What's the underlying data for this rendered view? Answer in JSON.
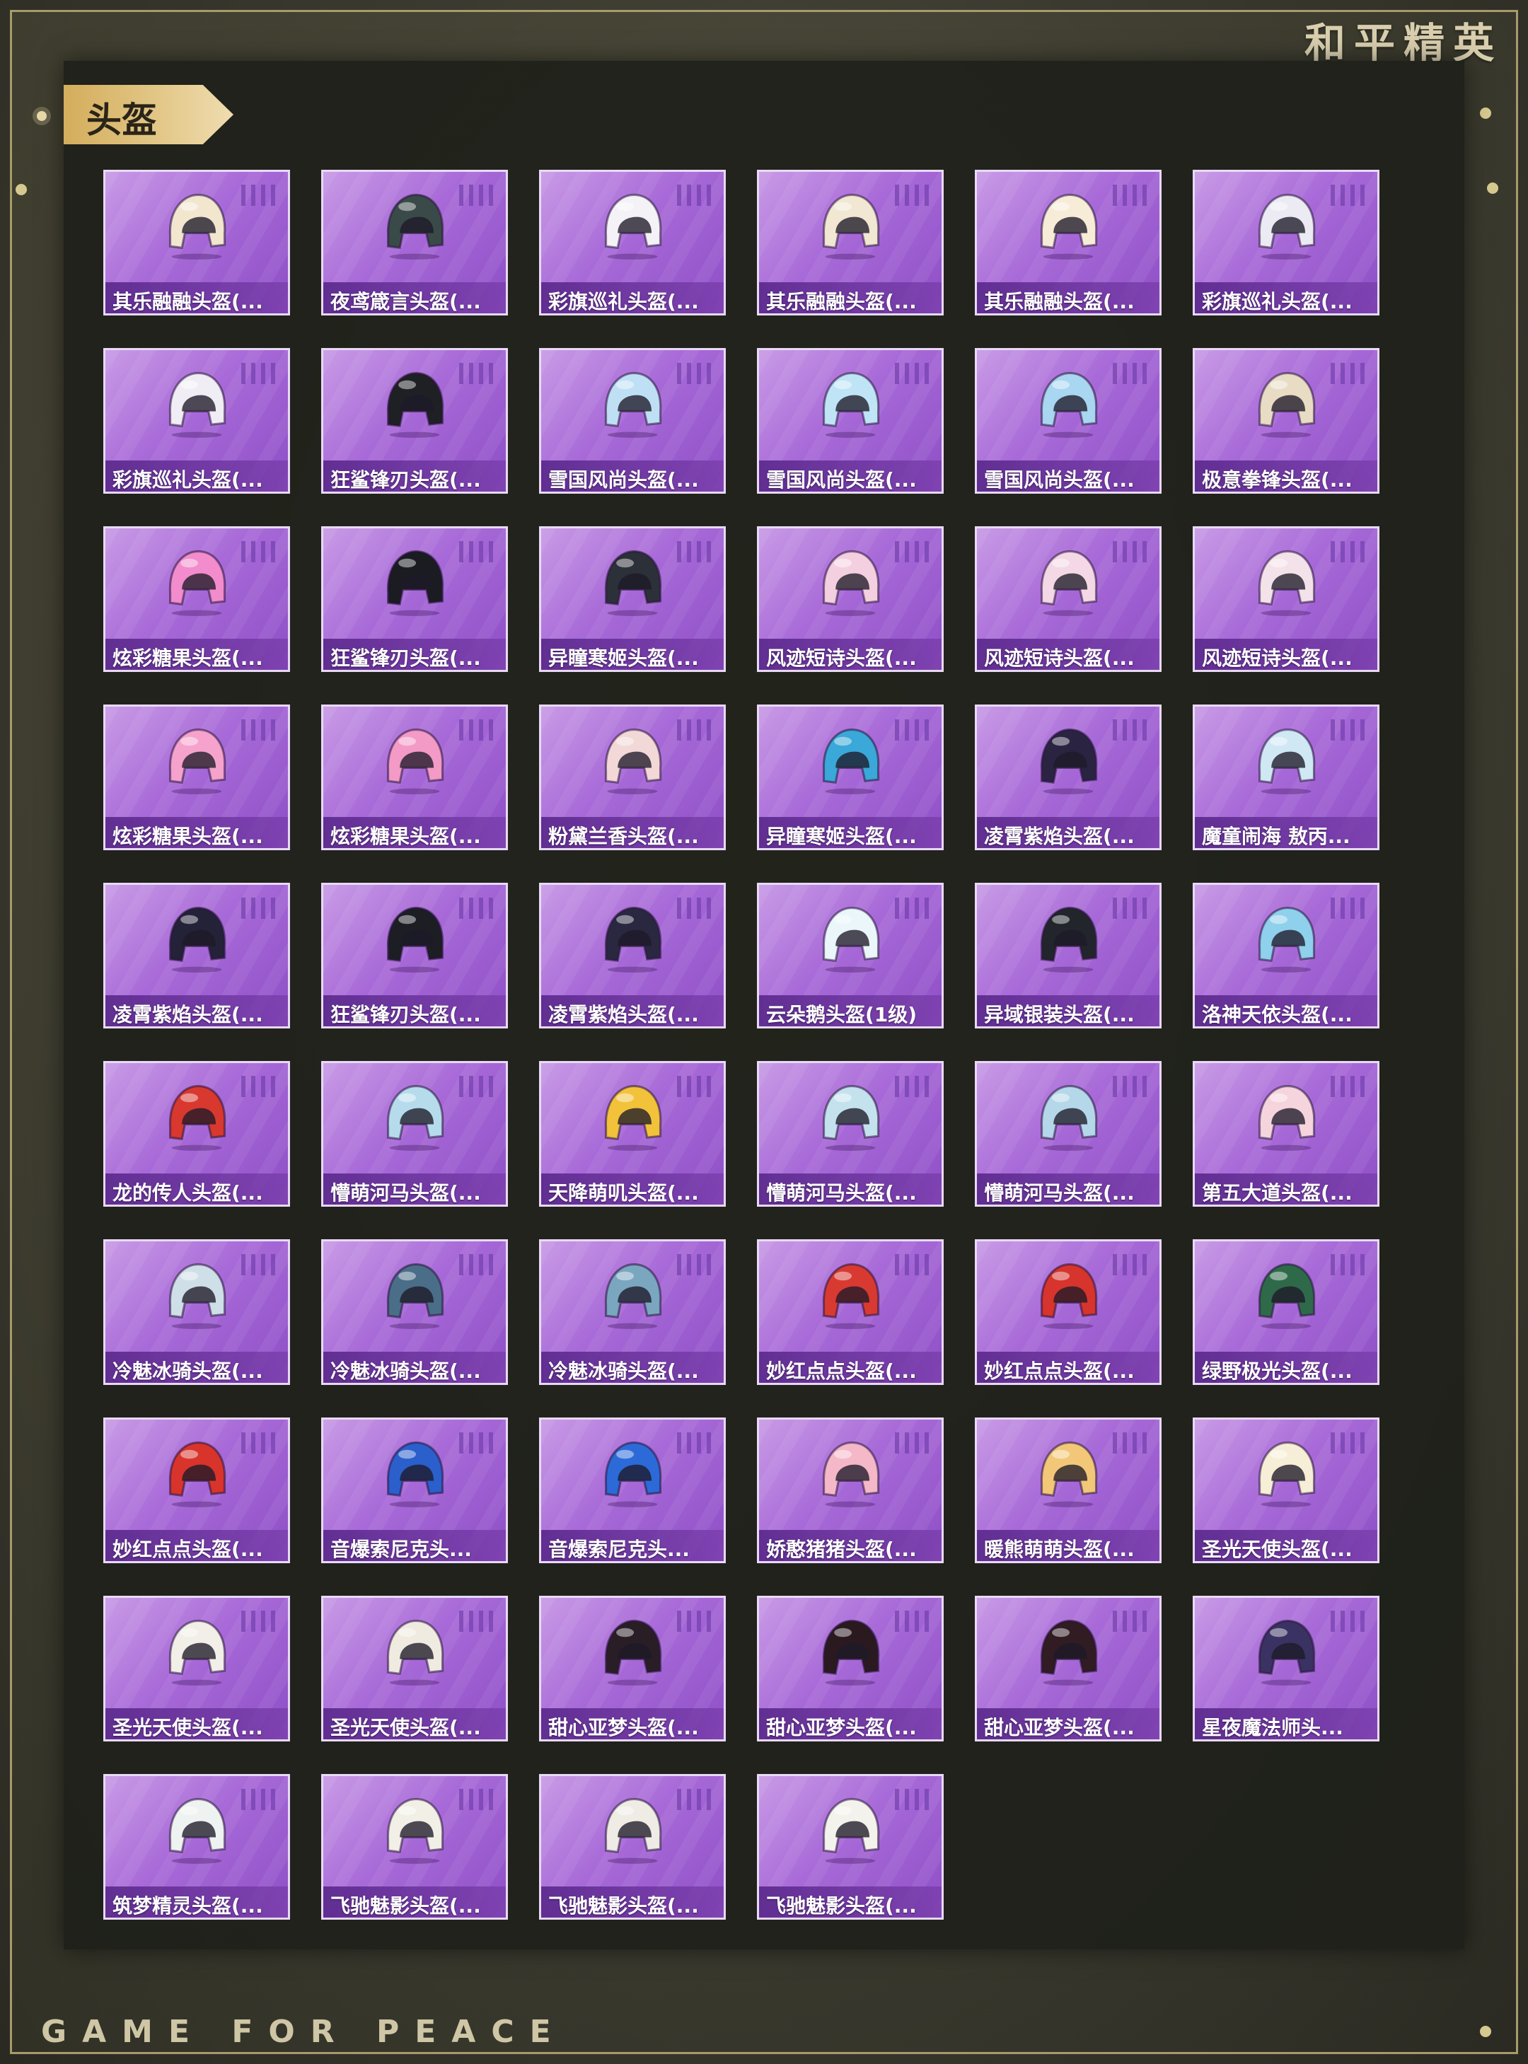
{
  "brand": {
    "title_cn": "和平精英",
    "title_en": "GAME FOR PEACE"
  },
  "section": {
    "title": "头盔"
  },
  "colors": {
    "card_purple": "#a86ad8",
    "frame_gold": "#a89a6a",
    "tab_gold": "#d4ad5c"
  },
  "items": [
    {
      "name": "其乐融融头盔(...",
      "icon": "helmet-icon",
      "color": "#f2e6cf"
    },
    {
      "name": "夜鸢箴言头盔(...",
      "icon": "helmet-icon",
      "color": "#3a4a48"
    },
    {
      "name": "彩旗巡礼头盔(...",
      "icon": "helmet-icon",
      "color": "#f4f2f6"
    },
    {
      "name": "其乐融融头盔(...",
      "icon": "helmet-icon",
      "color": "#f1e7d2"
    },
    {
      "name": "其乐融融头盔(...",
      "icon": "helmet-icon",
      "color": "#f7ecd8"
    },
    {
      "name": "彩旗巡礼头盔(...",
      "icon": "helmet-icon",
      "color": "#ecebf3"
    },
    {
      "name": "彩旗巡礼头盔(...",
      "icon": "helmet-icon",
      "color": "#f0eef4"
    },
    {
      "name": "狂鲨锋刃头盔(...",
      "icon": "helmet-icon",
      "color": "#1e2024"
    },
    {
      "name": "雪国风尚头盔(...",
      "icon": "helmet-icon",
      "color": "#bfe0f4"
    },
    {
      "name": "雪国风尚头盔(...",
      "icon": "helmet-icon",
      "color": "#bfe4f6"
    },
    {
      "name": "雪国风尚头盔(...",
      "icon": "helmet-icon",
      "color": "#a9d6f0"
    },
    {
      "name": "极意拳锋头盔(...",
      "icon": "helmet-icon",
      "color": "#e8dcc4"
    },
    {
      "name": "炫彩糖果头盔(...",
      "icon": "helmet-icon",
      "color": "#f28ccc"
    },
    {
      "name": "狂鲨锋刃头盔(...",
      "icon": "helmet-icon",
      "color": "#1a1c22"
    },
    {
      "name": "异瞳寒姬头盔(...",
      "icon": "helmet-icon",
      "color": "#2c3038"
    },
    {
      "name": "风迹短诗头盔(...",
      "icon": "helmet-icon",
      "color": "#f4cfe0"
    },
    {
      "name": "风迹短诗头盔(...",
      "icon": "helmet-icon",
      "color": "#f5d8e6"
    },
    {
      "name": "风迹短诗头盔(...",
      "icon": "helmet-icon",
      "color": "#f4e2ea"
    },
    {
      "name": "炫彩糖果头盔(...",
      "icon": "helmet-icon",
      "color": "#f5a2cc"
    },
    {
      "name": "炫彩糖果头盔(...",
      "icon": "helmet-icon",
      "color": "#f39ac6"
    },
    {
      "name": "粉黛兰香头盔(...",
      "icon": "helmet-icon",
      "color": "#f3d8d8"
    },
    {
      "name": "异瞳寒姬头盔(...",
      "icon": "helmet-icon",
      "color": "#3aa8d8"
    },
    {
      "name": "凌霄紫焰头盔(...",
      "icon": "helmet-icon",
      "color": "#2a2442"
    },
    {
      "name": "魔童闹海 敖丙...",
      "icon": "helmet-icon",
      "color": "#cfe8f4"
    },
    {
      "name": "凌霄紫焰头盔(...",
      "icon": "helmet-icon",
      "color": "#242238"
    },
    {
      "name": "狂鲨锋刃头盔(...",
      "icon": "helmet-icon",
      "color": "#1c1e24"
    },
    {
      "name": "凌霄紫焰头盔(...",
      "icon": "helmet-icon",
      "color": "#2a2840"
    },
    {
      "name": "云朵鹅头盔(1级)",
      "icon": "helmet-icon",
      "color": "#eaf6fa"
    },
    {
      "name": "异域银装头盔(...",
      "icon": "helmet-icon",
      "color": "#22262c"
    },
    {
      "name": "洛神天依头盔(...",
      "icon": "helmet-icon",
      "color": "#8fd0ec"
    },
    {
      "name": "龙的传人头盔(...",
      "icon": "helmet-icon",
      "color": "#d8382e"
    },
    {
      "name": "懵萌河马头盔(...",
      "icon": "helmet-icon",
      "color": "#b6dcec"
    },
    {
      "name": "天降萌叽头盔(...",
      "icon": "helmet-icon",
      "color": "#f2c23a"
    },
    {
      "name": "懵萌河马头盔(...",
      "icon": "helmet-icon",
      "color": "#c4e2ee"
    },
    {
      "name": "懵萌河马头盔(...",
      "icon": "helmet-icon",
      "color": "#b4d8ea"
    },
    {
      "name": "第五大道头盔(...",
      "icon": "helmet-icon",
      "color": "#f6d4de"
    },
    {
      "name": "冷魅冰骑头盔(...",
      "icon": "helmet-icon",
      "color": "#cfdfe8"
    },
    {
      "name": "冷魅冰骑头盔(...",
      "icon": "helmet-icon",
      "color": "#4a6e88"
    },
    {
      "name": "冷魅冰骑头盔(...",
      "icon": "helmet-icon",
      "color": "#7aa6c0"
    },
    {
      "name": "妙红点点头盔(...",
      "icon": "helmet-icon",
      "color": "#d83a32"
    },
    {
      "name": "妙红点点头盔(...",
      "icon": "helmet-icon",
      "color": "#d6342c"
    },
    {
      "name": "绿野极光头盔(...",
      "icon": "helmet-icon",
      "color": "#2e6a4a"
    },
    {
      "name": "妙红点点头盔(...",
      "icon": "helmet-icon",
      "color": "#d8342c"
    },
    {
      "name": "音爆索尼克头...",
      "icon": "helmet-icon",
      "color": "#2a5fcc"
    },
    {
      "name": "音爆索尼克头...",
      "icon": "helmet-icon",
      "color": "#2c6ad8"
    },
    {
      "name": "娇憨猪猪头盔(...",
      "icon": "helmet-icon",
      "color": "#f4b8c8"
    },
    {
      "name": "暖熊萌萌头盔(...",
      "icon": "helmet-icon",
      "color": "#f2c878"
    },
    {
      "name": "圣光天使头盔(...",
      "icon": "helmet-icon",
      "color": "#f6eed6"
    },
    {
      "name": "圣光天使头盔(...",
      "icon": "helmet-icon",
      "color": "#f2efe8"
    },
    {
      "name": "圣光天使头盔(...",
      "icon": "helmet-icon",
      "color": "#f0ebe0"
    },
    {
      "name": "甜心亚梦头盔(...",
      "icon": "helmet-icon",
      "color": "#2a1e26"
    },
    {
      "name": "甜心亚梦头盔(...",
      "icon": "helmet-icon",
      "color": "#2a1a20"
    },
    {
      "name": "甜心亚梦头盔(...",
      "icon": "helmet-icon",
      "color": "#301c22"
    },
    {
      "name": "星夜魔法师头...",
      "icon": "helmet-icon",
      "color": "#3a3262"
    },
    {
      "name": "筑梦精灵头盔(...",
      "icon": "helmet-icon",
      "color": "#eef2f0"
    },
    {
      "name": "飞驰魅影头盔(...",
      "icon": "helmet-icon",
      "color": "#f2f0e6"
    },
    {
      "name": "飞驰魅影头盔(...",
      "icon": "helmet-icon",
      "color": "#eeece4"
    },
    {
      "name": "飞驰魅影头盔(...",
      "icon": "helmet-icon",
      "color": "#f4f2ec"
    }
  ]
}
